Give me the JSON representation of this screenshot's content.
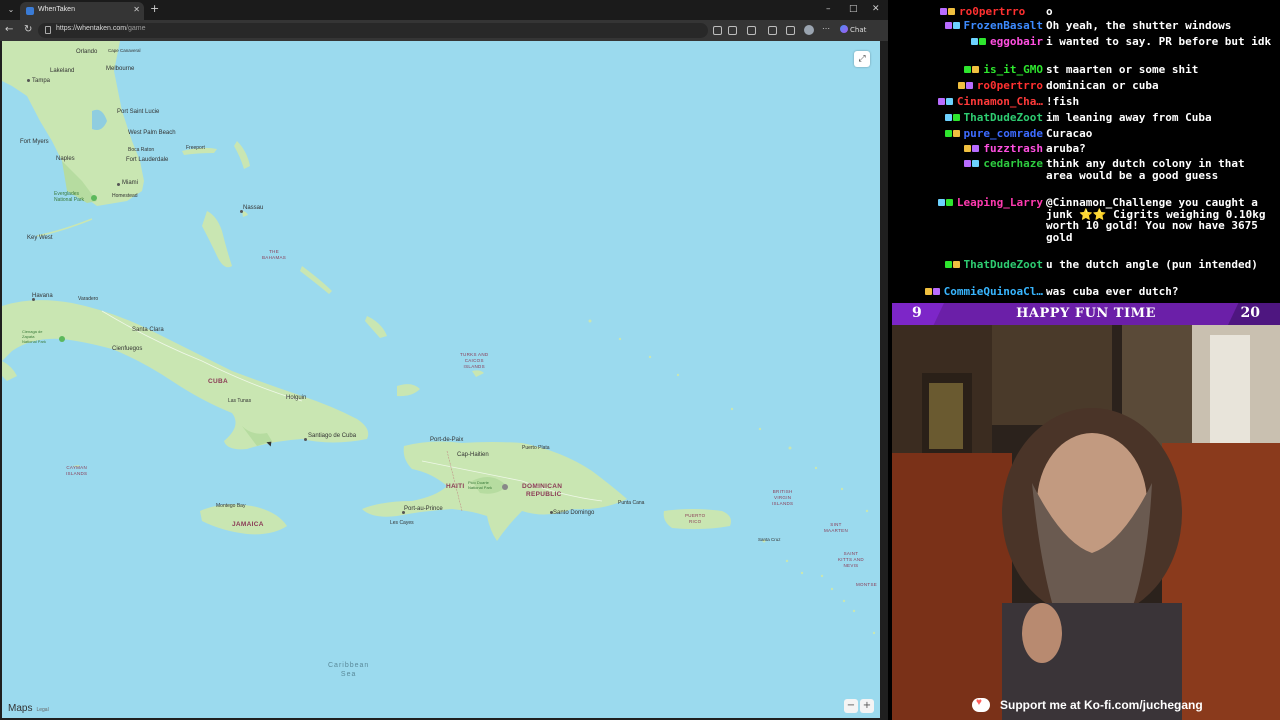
{
  "browser": {
    "tab_title": "WhenTaken",
    "url_host": "https://whentaken.com",
    "url_path": "/game",
    "chat_label": "Chat"
  },
  "map": {
    "countries": [
      {
        "name": "CUBA"
      },
      {
        "name": "HAITI"
      },
      {
        "name": "DOMINICAN"
      },
      {
        "name": "REPUBLIC"
      },
      {
        "name": "JAMAICA"
      }
    ],
    "regions": [
      "THE\nBAHAMAS",
      "TURKS AND\nCAICOS\nISLANDS",
      "CAYMAN\nISLANDS",
      "PUERTO\nRICO",
      "BRITISH\nVIRGIN\nISLANDS",
      "SINT\nMAARTEN",
      "SAINT\nKITTS AND\nNEVIS",
      "MONTSE"
    ],
    "cities": [
      "Orlando",
      "Cape Canaveral",
      "Lakeland",
      "Melbourne",
      "Tampa",
      "Port Saint Lucie",
      "West Palm Beach",
      "Fort Myers",
      "Boca Raton",
      "Freeport",
      "Naples",
      "Fort Lauderdale",
      "Miami",
      "Homestead",
      "Nassau",
      "Key West",
      "Havana",
      "Varadero",
      "Santa Clara",
      "Cienfuegos",
      "Las Tunas",
      "Holguin",
      "Santiago de Cuba",
      "Port-de-Paix",
      "Cap-Haitien",
      "Puerto Plata",
      "Santo Domingo",
      "Punta Cana",
      "Port-au-Prince",
      "Les Cayes",
      "Montego Bay",
      "Santa Cruz"
    ],
    "parks": [
      "Everglades\nNational Park",
      "Cienaga de\nZapata\nNational Park",
      "Pico Duarte\nNational Park"
    ],
    "sea": "Caribbean\nSea",
    "brand": "Maps",
    "legal": "Legal"
  },
  "chat": {
    "messages": [
      {
        "user": "FrozenBasalt",
        "color": "#3d8bff",
        "text": "Oh yeah, the shutter windows"
      },
      {
        "user": "eggobair",
        "color": "#ff4fe0",
        "text": "i wanted to say. PR before but idk"
      },
      {
        "user": "is_it_GMO",
        "color": "#2ee62e",
        "text": "st maarten or some shit"
      },
      {
        "user": "ro0pertrro",
        "color": "#ff3030",
        "text": "dominican or cuba"
      },
      {
        "user": "Cinnamon_Cha…",
        "color": "#ff3a3a",
        "text": "!fish"
      },
      {
        "user": "ThatDudeZoot",
        "color": "#2ecc71",
        "text": "im leaning away from Cuba"
      },
      {
        "user": "pure_comrade",
        "color": "#3d6bff",
        "text": "Curacao"
      },
      {
        "user": "fuzztrash",
        "color": "#ff4fe0",
        "text": "aruba?"
      },
      {
        "user": "cedarhaze",
        "color": "#2ecc40",
        "text": "think any dutch colony in that area would be a good guess"
      },
      {
        "user": "Leaping_Larry",
        "color": "#ff3ab0",
        "text": "@Cinnamon_Challenge you caught a junk ⭐⭐ Cigrits weighing 0.10kg worth 10 gold! You now have 3675 gold"
      },
      {
        "user": "ThatDudeZoot",
        "color": "#2ecc71",
        "text": "u the dutch angle (pun intended)"
      },
      {
        "user": "CommieQuinoaCl…",
        "color": "#38b6ff",
        "text": "was cuba ever dutch?"
      }
    ],
    "top_partial_1": "o",
    "top_partial_user": "ro0pertrro"
  },
  "stream": {
    "left_num": "9",
    "title": "HAPPY FUN TIME",
    "right_num": "20",
    "kofi_text": "Support me at Ko-fi.com/juchegang"
  }
}
